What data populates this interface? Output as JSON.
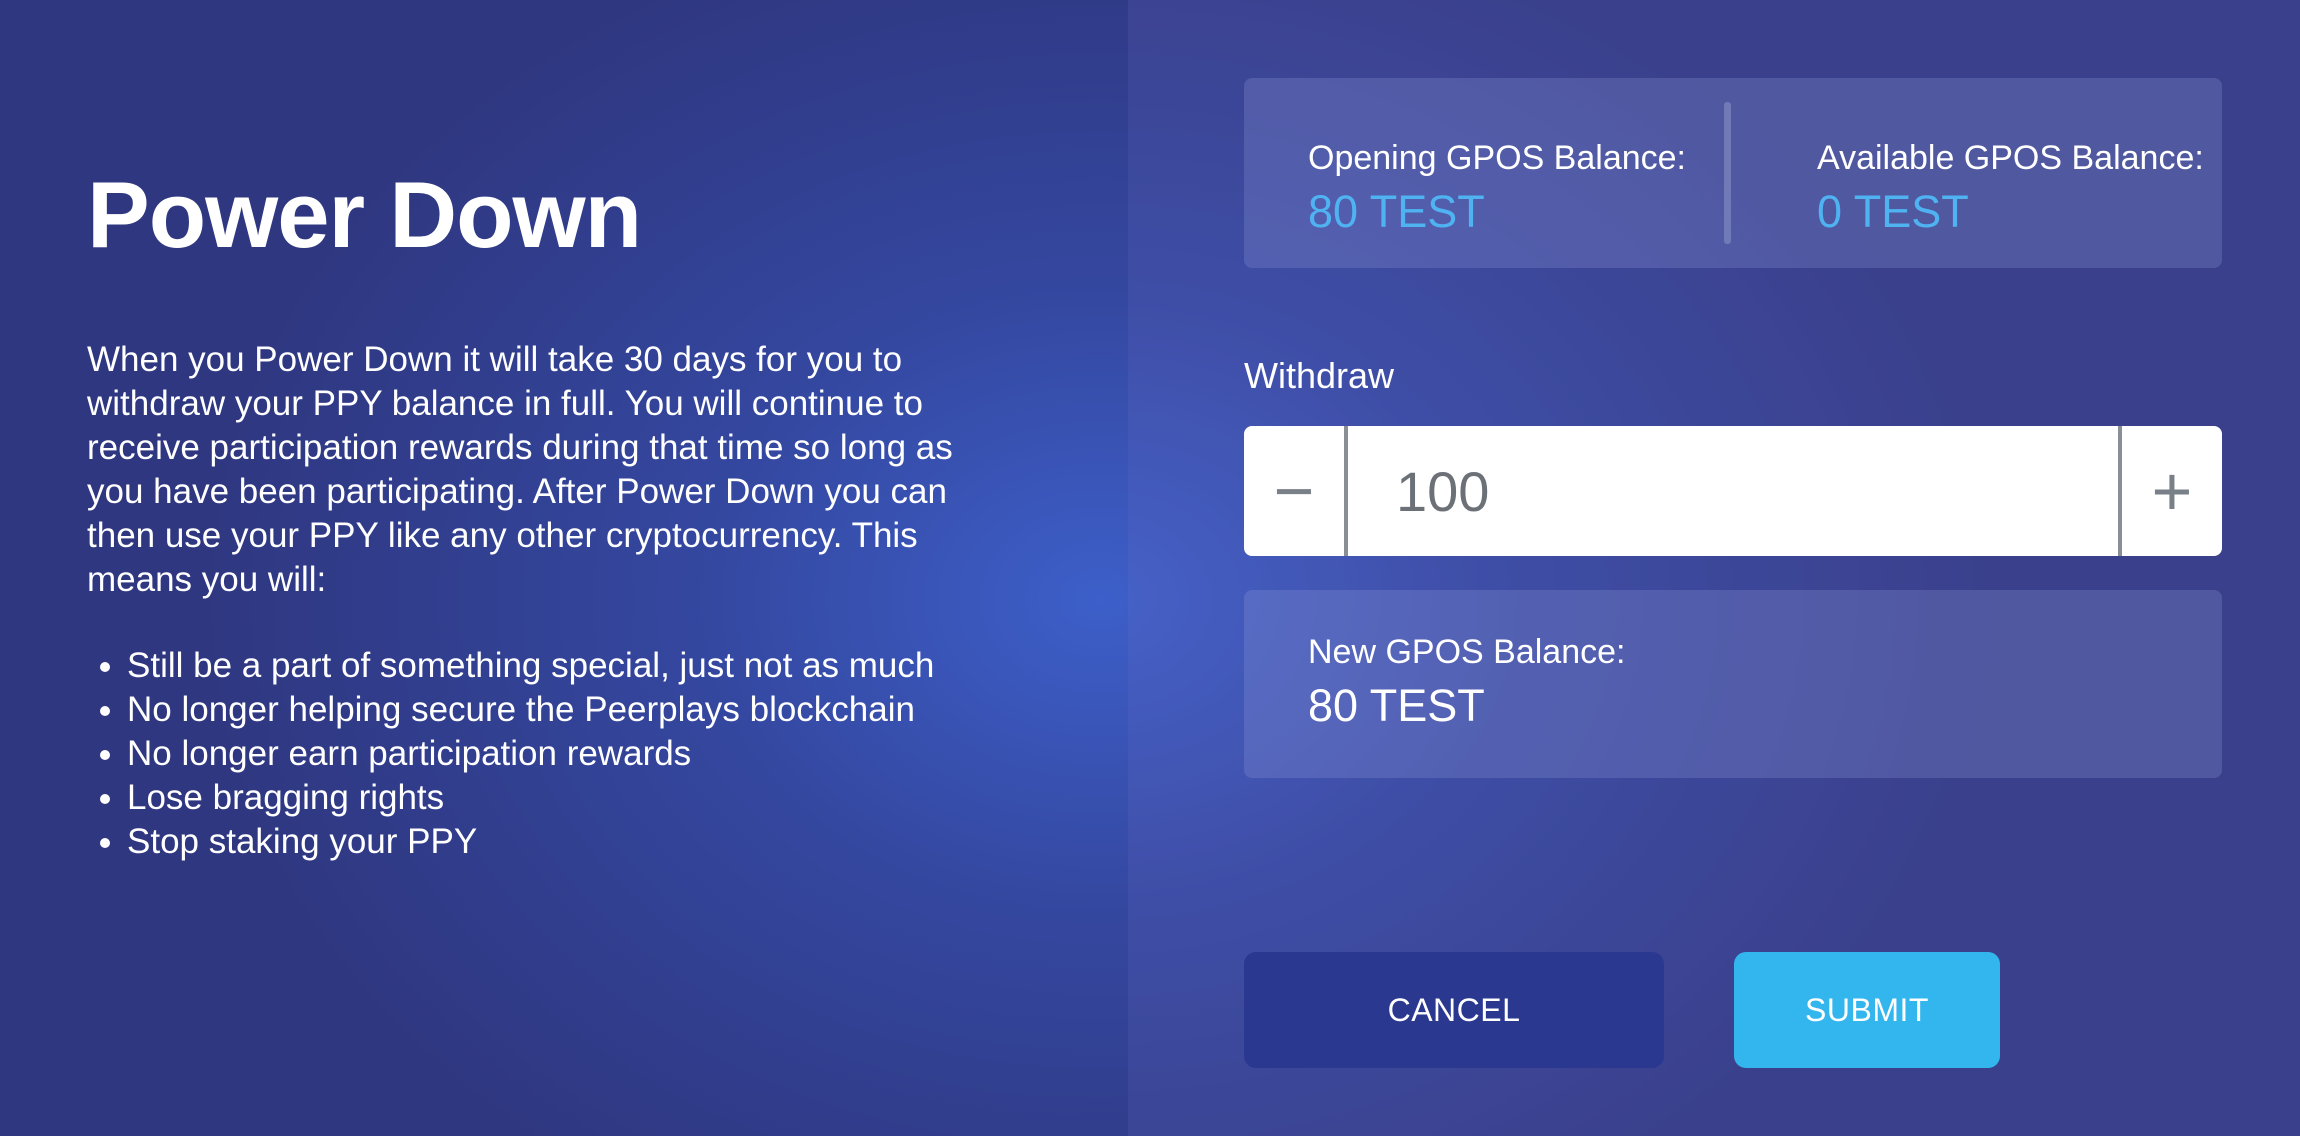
{
  "title": "Power Down",
  "description": "When you Power Down it will take 30 days for you to withdraw your PPY balance in full. You will continue to receive participation rewards during that time so long as you have been participating. After Power Down you can then use your PPY like any other cryptocurrency. This means you will:",
  "bullets": [
    "Still be a part of something special, just not as much",
    "No longer helping secure the Peerplays blockchain",
    "No longer earn participation rewards",
    "Lose bragging rights",
    "Stop staking your PPY"
  ],
  "balances": {
    "opening": {
      "label": "Opening GPOS Balance:",
      "value": "80 TEST"
    },
    "available": {
      "label": "Available GPOS Balance:",
      "value": "0 TEST"
    },
    "new": {
      "label": "New GPOS Balance:",
      "value": "80 TEST"
    }
  },
  "withdraw": {
    "label": "Withdraw",
    "value": "100",
    "minus_symbol": "−",
    "plus_symbol": "+"
  },
  "buttons": {
    "cancel_label": "CANCEL",
    "submit_label": "SUBMIT"
  },
  "colors": {
    "accent_value": "#4fb3f2",
    "submit": "#33b6ee",
    "cancel": "#2a3890"
  },
  "icons": {
    "minus": "minus-icon",
    "plus": "plus-icon"
  }
}
